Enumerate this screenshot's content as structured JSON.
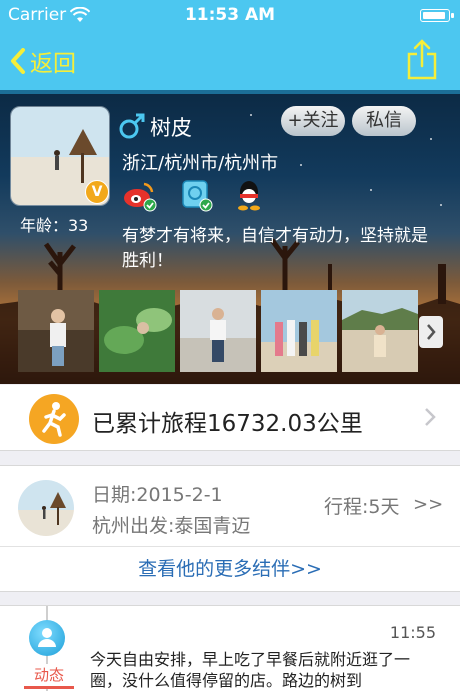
{
  "status_bar": {
    "carrier": "Carrier",
    "time": "11:53 AM",
    "battery_level": 1.0
  },
  "nav": {
    "back_label": "返回",
    "back_icon": "chevron-left-icon",
    "share_icon": "share-icon"
  },
  "profile": {
    "name": "树皮",
    "gender_icon": "male-icon",
    "location": "浙江/杭州市/杭州市",
    "age": "年龄：33",
    "vip_label": "V",
    "follow_label": "+关注",
    "message_label": "私信",
    "signature": "有梦才有将来，自信才有动力，坚持就是胜利！",
    "social_icons": [
      "weibo-icon",
      "wallet-icon",
      "qq-icon"
    ],
    "photos": [
      "photo-1",
      "photo-2",
      "photo-3",
      "photo-4",
      "photo-5"
    ]
  },
  "distance": {
    "text": "已累计旅程16732.03公里",
    "icon": "running-icon"
  },
  "trip": {
    "date": "日期:2015-2-1",
    "route": "杭州出发:泰国青迈",
    "days": "行程:5天",
    "more": ">>",
    "more_partners": "查看他的更多结伴>>"
  },
  "feed": {
    "label": "动态",
    "time": "11:55",
    "text": "今天自由安排，早上吃了早餐后就附近逛了一圈，没什么值得停留的店。路边的树到"
  },
  "colors": {
    "nav_bg": "#4cc7f0",
    "accent_yellow": "#f5ee3a",
    "link_blue": "#2a6db5",
    "tab_red": "#e8584b"
  }
}
